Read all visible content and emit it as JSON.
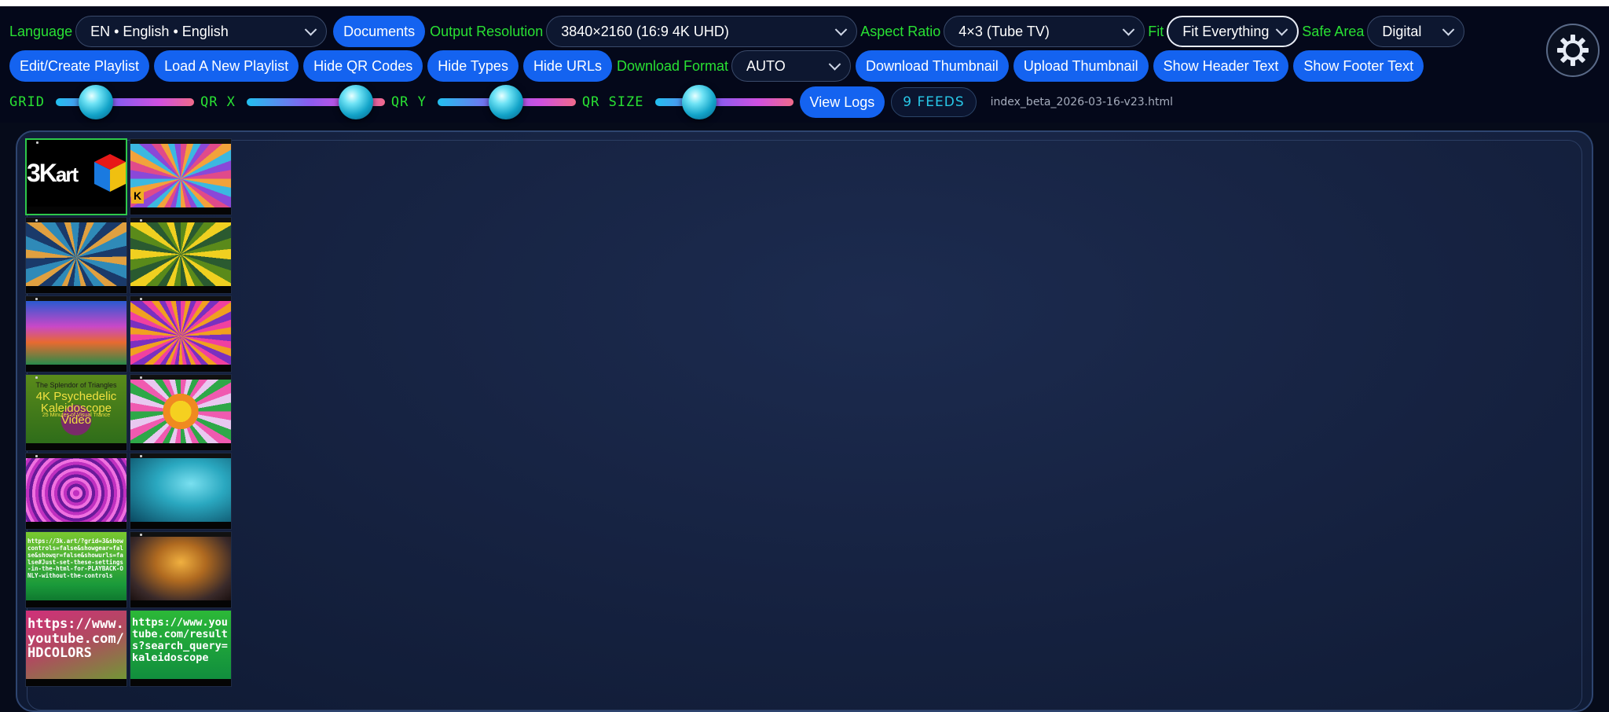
{
  "toolbar": {
    "language_label": "Language",
    "language_value": "EN • English • English",
    "documents_button": "Documents",
    "output_resolution_label": "Output Resolution",
    "output_resolution_value": "3840×2160 (16:9 4K UHD)",
    "aspect_ratio_label": "Aspect Ratio",
    "aspect_ratio_value": "4×3 (Tube TV)",
    "fit_label": "Fit",
    "fit_value": "Fit Everything",
    "safe_area_label": "Safe Area",
    "safe_area_value": "Digital",
    "edit_playlist_button": "Edit/Create Playlist",
    "load_playlist_button": "Load A New Playlist",
    "hide_qr_button": "Hide QR Codes",
    "hide_types_button": "Hide Types",
    "hide_urls_button": "Hide URLs",
    "download_format_label": "Download Format",
    "download_format_value": "AUTO",
    "download_thumbnail_button": "Download Thumbnail",
    "upload_thumbnail_button": "Upload Thumbnail",
    "show_header_button": "Show Header Text",
    "show_footer_button": "Show Footer Text",
    "grid_label": "GRID",
    "qrx_label": "QR X",
    "qry_label": "QR Y",
    "qrsize_label": "QR SIZE",
    "view_logs_button": "View Logs",
    "feeds_badge": "9 FEEDS",
    "filename": "index_beta_2026-03-16-v23.html"
  },
  "sliders": {
    "grid": 0.22,
    "qr_x": 0.89,
    "qr_y": 0.49,
    "qr_size": 0.26
  },
  "tiles": {
    "logo_text": "3K",
    "logo_sub": "art",
    "splendor_title": "The Splendor of Triangles",
    "splendor_main": "4K Psychedelic Kaleidoscope Video",
    "splendor_sub": "25 Minutes of Visual Trance",
    "k_badge": "K",
    "url_small": "https://3k.art/?grid=3&showcontrols=false&showgear=false&showqr=false&showurls=false#Just-set-these-settings-in-the-html-for-PLAYBACK-ONLY-without-the-controls",
    "url_channel": "https://www.youtube.com/HDCOLORS",
    "url_search": "https://www.youtube.com/results?search_query=kaleidoscope"
  },
  "colors": {
    "accent_blue": "#1463f0",
    "label_green": "#29e033",
    "badge_cyan": "#28c8e8",
    "background": "#060b1a"
  }
}
